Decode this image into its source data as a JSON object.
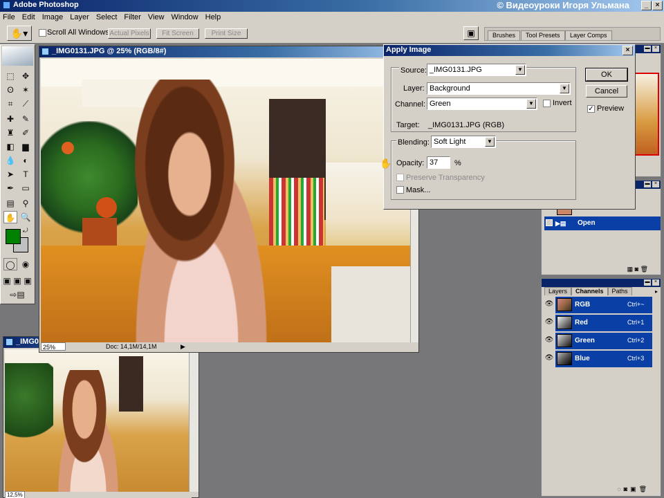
{
  "app": {
    "title": "Adobe Photoshop",
    "watermark": "© Видеоуроки Игоря Ульмана"
  },
  "menu": [
    "File",
    "Edit",
    "Image",
    "Layer",
    "Select",
    "Filter",
    "View",
    "Window",
    "Help"
  ],
  "options": {
    "scroll_all": "Scroll All Windows",
    "actual_pixels": "Actual Pixels",
    "fit_screen": "Fit Screen",
    "print_size": "Print Size"
  },
  "palette_well": {
    "tabs": [
      "Brushes",
      "Tool Presets",
      "Layer Comps"
    ]
  },
  "doc_main": {
    "title": "_IMG0131.JPG @ 25% (RGB/8#)",
    "zoom": "25%",
    "doc_size": "Doc: 14,1M/14,1M"
  },
  "doc_second": {
    "title": "_IMG0",
    "zoom": "12,5%"
  },
  "dialog": {
    "title": "Apply Image",
    "source_label": "Source:",
    "source_value": "_IMG0131.JPG",
    "layer_label": "Layer:",
    "layer_value": "Background",
    "channel_label": "Channel:",
    "channel_value": "Green",
    "invert_label": "Invert",
    "target_label": "Target:",
    "target_value": "_IMG0131.JPG (RGB)",
    "blending_label": "Blending:",
    "blending_value": "Soft Light",
    "opacity_label": "Opacity:",
    "opacity_value": "37",
    "opacity_unit": "%",
    "preserve_label": "Preserve Transparency",
    "mask_label": "Mask...",
    "ok_label": "OK",
    "cancel_label": "Cancel",
    "preview_label": "Preview",
    "preview_checked": true
  },
  "history": {
    "item": "Open"
  },
  "channels_panel": {
    "tabs": [
      "Layers",
      "Channels",
      "Paths"
    ],
    "rows": [
      {
        "name": "RGB",
        "shortcut": "Ctrl+~"
      },
      {
        "name": "Red",
        "shortcut": "Ctrl+1"
      },
      {
        "name": "Green",
        "shortcut": "Ctrl+2"
      },
      {
        "name": "Blue",
        "shortcut": "Ctrl+3"
      }
    ]
  },
  "colors": {
    "foreground": "#008000",
    "background": "#c0c0c0",
    "selection": "#0a3fa6"
  }
}
